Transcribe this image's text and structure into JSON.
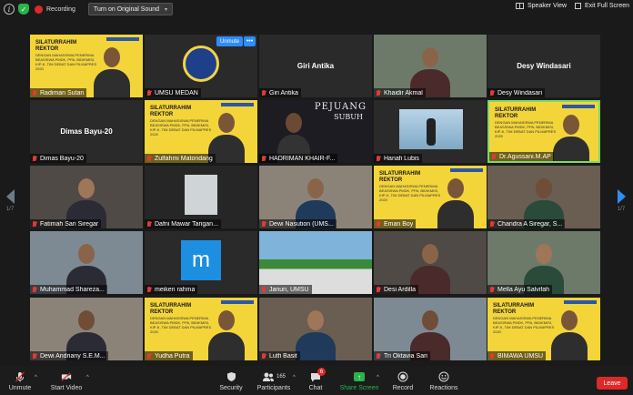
{
  "topbar": {
    "recording_label": "Recording",
    "original_sound_label": "Turn on Original Sound",
    "speaker_view_label": "Speaker View",
    "exit_fullscreen_label": "Exit Full Screen"
  },
  "pagination": {
    "left": "1/7",
    "right": "1/7"
  },
  "tile_overlay": {
    "unmute_label": "Unmute",
    "more_label": "•••"
  },
  "slide": {
    "title_line1": "SILATURRAHIM",
    "title_line2": "REKTOR",
    "subtitle": "DENGAN MAHASISWA PENERIMA BEASISWA PMDK, PPA, BIDIKMISI, KIP-K, TIM DEBAT DAN PILMAPRES 2020",
    "pejuang_title": "PEJUANG",
    "pejuang_sub": "SUBUH"
  },
  "participants": [
    {
      "name": "Radiman Sutan",
      "row": 0,
      "col": 0,
      "style": "yellow"
    },
    {
      "name": "UMSU MEDAN",
      "row": 0,
      "col": 1,
      "style": "logo"
    },
    {
      "name": "Giri Antika",
      "row": 0,
      "col": 2,
      "style": "nameonly"
    },
    {
      "name": "Khaidir Akmal",
      "row": 0,
      "col": 3,
      "style": "cam"
    },
    {
      "name": "Desy Windasari",
      "row": 0,
      "col": 4,
      "style": "nameonly"
    },
    {
      "name": "Dimas Bayu-20",
      "row": 1,
      "col": 0,
      "style": "nameonly"
    },
    {
      "name": "Zulfahmi Matondang",
      "row": 1,
      "col": 1,
      "style": "yellow"
    },
    {
      "name": "HADRIMAN KHAIR-F...",
      "row": 1,
      "col": 2,
      "style": "pejuang"
    },
    {
      "name": "Hanafi Lubis",
      "row": 1,
      "col": 3,
      "style": "photo"
    },
    {
      "name": "Dr.Agussani.M.AP",
      "row": 1,
      "col": 4,
      "style": "yellow-talk"
    },
    {
      "name": "Fatimah Sari Siregar",
      "row": 2,
      "col": 0,
      "style": "cam"
    },
    {
      "name": "Dafni Mawar Tarigan...",
      "row": 2,
      "col": 1,
      "style": "dark"
    },
    {
      "name": "Dewi Nasution (UMS...",
      "row": 2,
      "col": 2,
      "style": "cam"
    },
    {
      "name": "Eman Boy",
      "row": 2,
      "col": 3,
      "style": "yellow"
    },
    {
      "name": "Chandra A Siregar, S...",
      "row": 2,
      "col": 4,
      "style": "cam"
    },
    {
      "name": "Muhammad Shareza...",
      "row": 3,
      "col": 0,
      "style": "cam"
    },
    {
      "name": "meiken rahma",
      "row": 3,
      "col": 1,
      "style": "m"
    },
    {
      "name": "Januri, UMSU",
      "row": 3,
      "col": 2,
      "style": "building"
    },
    {
      "name": "Desi Ardilla",
      "row": 3,
      "col": 3,
      "style": "cam"
    },
    {
      "name": "Mella Ayu Salvifah",
      "row": 3,
      "col": 4,
      "style": "cam"
    },
    {
      "name": "Dewi Andriany S.E.M...",
      "row": 4,
      "col": 0,
      "style": "cam"
    },
    {
      "name": "Yudha Putra",
      "row": 4,
      "col": 1,
      "style": "yellow"
    },
    {
      "name": "Lutfi Basit",
      "row": 4,
      "col": 2,
      "style": "cam"
    },
    {
      "name": "Tri Oktavia Sari",
      "row": 4,
      "col": 3,
      "style": "cam"
    },
    {
      "name": "BIMAWA UMSU",
      "row": 4,
      "col": 4,
      "style": "yellow"
    }
  ],
  "toolbar": {
    "unmute": "Unmute",
    "start_video": "Start Video",
    "security": "Security",
    "participants": "Participants",
    "participants_count": "165",
    "chat": "Chat",
    "chat_badge": "6",
    "share_screen": "Share Screen",
    "record": "Record",
    "reactions": "Reactions",
    "leave": "Leave"
  },
  "colors": {
    "accent_blue": "#2d8cff",
    "share_green": "#2bb34b",
    "leave_red": "#e02828",
    "slide_yellow": "#f3d53a"
  }
}
